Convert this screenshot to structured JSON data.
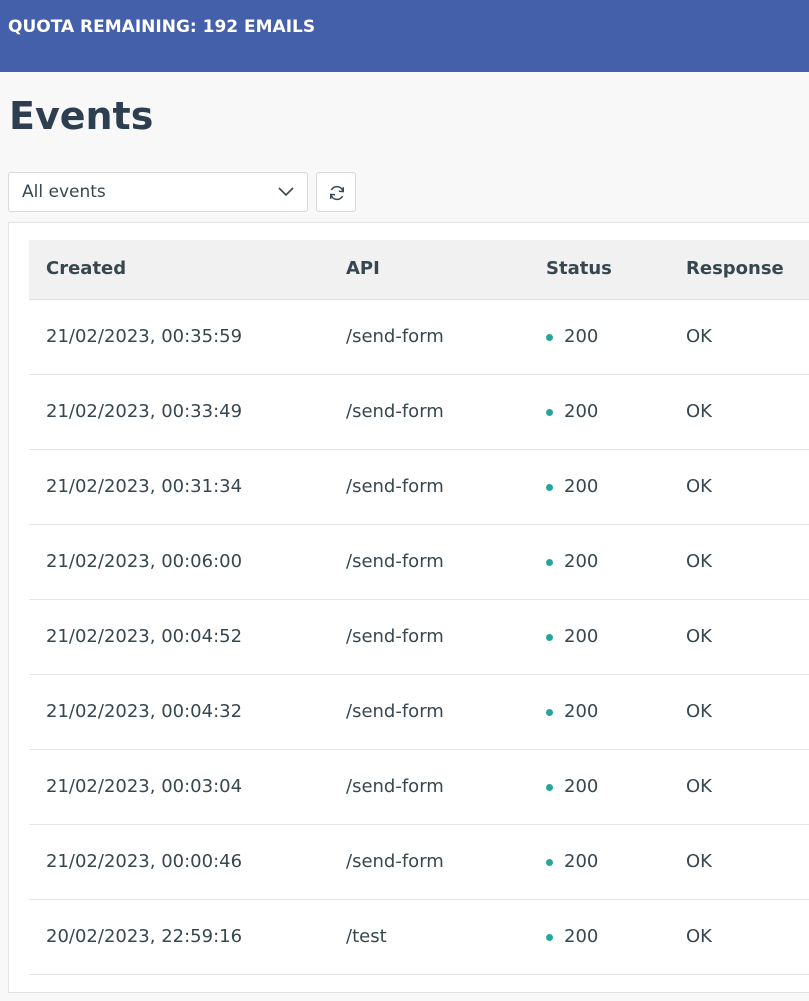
{
  "banner": {
    "text": "QUOTA REMAINING: 192 EMAILS",
    "color": "#4460ab"
  },
  "page": {
    "title": "Events"
  },
  "filter": {
    "selected": "All events",
    "icon": "chevron-down-icon"
  },
  "refresh": {
    "icon": "refresh-icon"
  },
  "table": {
    "headers": {
      "created": "Created",
      "api": "API",
      "status": "Status",
      "response": "Response"
    },
    "status_dot_color": "#26a69a",
    "rows": [
      {
        "created": "21/02/2023, 00:35:59",
        "api": "/send-form",
        "status": "200",
        "response": "OK"
      },
      {
        "created": "21/02/2023, 00:33:49",
        "api": "/send-form",
        "status": "200",
        "response": "OK"
      },
      {
        "created": "21/02/2023, 00:31:34",
        "api": "/send-form",
        "status": "200",
        "response": "OK"
      },
      {
        "created": "21/02/2023, 00:06:00",
        "api": "/send-form",
        "status": "200",
        "response": "OK"
      },
      {
        "created": "21/02/2023, 00:04:52",
        "api": "/send-form",
        "status": "200",
        "response": "OK"
      },
      {
        "created": "21/02/2023, 00:04:32",
        "api": "/send-form",
        "status": "200",
        "response": "OK"
      },
      {
        "created": "21/02/2023, 00:03:04",
        "api": "/send-form",
        "status": "200",
        "response": "OK"
      },
      {
        "created": "21/02/2023, 00:00:46",
        "api": "/send-form",
        "status": "200",
        "response": "OK"
      },
      {
        "created": "20/02/2023, 22:59:16",
        "api": "/test",
        "status": "200",
        "response": "OK"
      }
    ]
  }
}
